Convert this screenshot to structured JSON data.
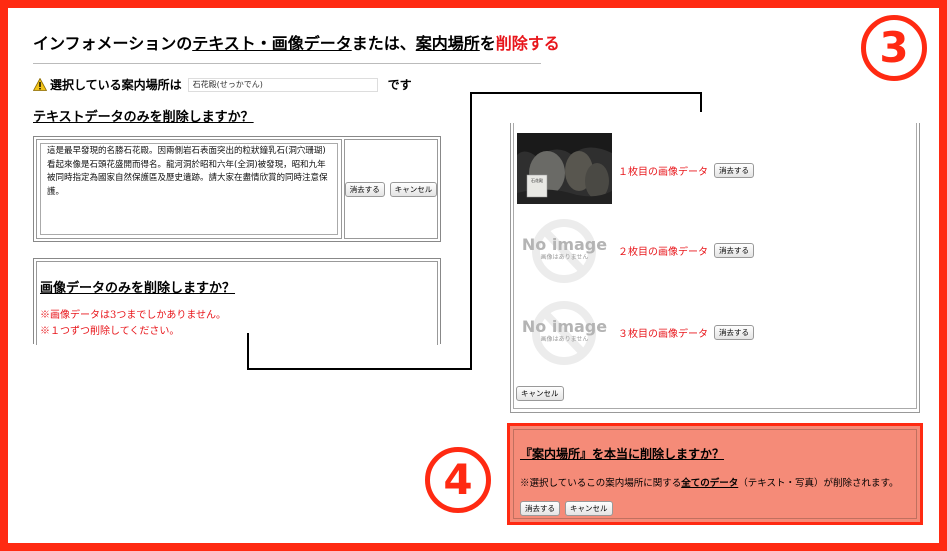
{
  "title": {
    "part1": "インフォメーションの",
    "part2": "テキスト・画像データ",
    "part3": "または、",
    "part4": "案内場所",
    "part5": "を",
    "part6": "削除する"
  },
  "selected": {
    "label": "選択している案内場所は",
    "value": "石花殿(せっかでん)",
    "suffix": "です"
  },
  "text_section": {
    "heading": "テキストデータのみを削除しますか？",
    "content": "這是最早發現的名勝石花殿。因兩側岩石表面突出的粒狀鐘乳石(洞穴珊瑚)看起來像是石頭花盛開而得名。龍河洞於昭和六年(全洞)被發現，昭和九年被同時指定為國家自然保護區及歷史遺跡。請大家在盡情欣賞的同時注意保護。",
    "delete_button": "消去する",
    "cancel_button": "キャンセル"
  },
  "image_section": {
    "heading": "画像データのみを削除しますか？",
    "note1": "※画像データは3つまでしかありません。",
    "note2": "※１つずつ削除してください。"
  },
  "badges": {
    "step3": "3",
    "step4": "4"
  },
  "image_panel": {
    "items": [
      {
        "label": "１枚目の画像データ",
        "button": "消去する",
        "thumb": "photo",
        "sign_text": "石花殿"
      },
      {
        "label": "２枚目の画像データ",
        "button": "消去する",
        "thumb": "no-image"
      },
      {
        "label": "３枚目の画像データ",
        "button": "消去する",
        "thumb": "no-image"
      }
    ],
    "no_image_title": "No image",
    "no_image_sub": "画像はありません",
    "cancel_button": "キャンセル"
  },
  "confirm_panel": {
    "title": "『案内場所』を本当に削除しますか？",
    "note_prefix": "※選択しているこの案内場所に関する",
    "note_bold": "全てのデータ",
    "note_suffix": "（テキスト・写真）が削除されます。",
    "delete_button": "消去する",
    "cancel_button": "キャンセル"
  },
  "colors": {
    "accent": "#ff2a12",
    "warning_red": "#e8161b",
    "confirm_bg": "#f58b78"
  }
}
